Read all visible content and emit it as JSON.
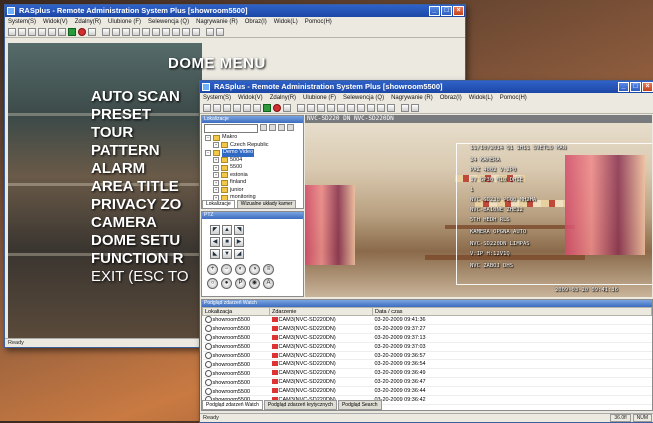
{
  "back_window": {
    "title": "RASplus - Remote Administration System Plus [showroom5500]",
    "menu": [
      "System(S)",
      "Widok(V)",
      "Zdalny(R)",
      "Ulubione (F)",
      "Selewencja (Q)",
      "Nagrywanie (R)",
      "Obraz(I)",
      "Widok(L)",
      "Pomoc(H)"
    ],
    "status": "Ready",
    "dome_menu": {
      "title": "DOME MENU",
      "items": [
        "AUTO SCAN",
        "PRESET",
        "TOUR",
        "PATTERN",
        "ALARM",
        "AREA TITLE",
        "PRIVACY ZO",
        "CAMERA",
        "DOME SETU",
        "FUNCTION R"
      ],
      "exit": "EXIT (ESC TO"
    }
  },
  "front_window": {
    "title": "RASplus - Remote Administration System Plus [showroom5500]",
    "menu": [
      "System(S)",
      "Widok(V)",
      "Zdalny(R)",
      "Ulubione (F)",
      "Selewencja (Q)",
      "Nagrywanie (R)",
      "Obraz(I)",
      "Widok(L)",
      "Pomoc(H)"
    ],
    "locations_panel": {
      "header": "Lokalizacje",
      "tree": [
        {
          "label": "Makro",
          "level": 0
        },
        {
          "label": "Czech Republic",
          "level": 1
        },
        {
          "label": "Demo Video",
          "level": 0,
          "selected": true
        },
        {
          "label": "5004",
          "level": 1
        },
        {
          "label": "5500",
          "level": 1
        },
        {
          "label": "estonia",
          "level": 1
        },
        {
          "label": "finland",
          "level": 1
        },
        {
          "label": "junior",
          "level": 1
        },
        {
          "label": "monitoring",
          "level": 1
        }
      ],
      "tabs": [
        "Lokalizacje",
        "Wizualne układy kamer"
      ]
    },
    "ptz_panel": {
      "header": "PTZ"
    },
    "video": {
      "title": "NVC-SD220 DN  NVC-SD220DN",
      "osd_lines": [
        "11/10/2014 Q1  1H11 SVETLO MAN",
        "24 KAMERA",
        "PAZ 4002  V:2P0",
        "3V GP30 M10 DHIE",
        "1",
        "NVC-SD230 PC00  MH2HA",
        "NVC-BA10NE  ZHE12",
        "5TH HEDH RLS",
        "KAMERA  OPGNA AUTO",
        "NVC-SD220DN  LIMPAS",
        "V:IP H:12V1Q",
        "NVC ZABOJ DHS"
      ],
      "timestamp": "2009-03-20 09:41:36"
    },
    "events_panel": {
      "header": "Podgląd zdarzeń Watch",
      "columns": [
        "Lokalizacja",
        "Zdarzenie",
        "Data / czas"
      ],
      "rows": [
        {
          "location": "showroom5500",
          "event": "CAM3(NVC-SD220DN)",
          "time": "03-20-2009 09:41:36"
        },
        {
          "location": "showroom5500",
          "event": "CAM3(NVC-SD220DN)",
          "time": "03-20-2009 09:37:27"
        },
        {
          "location": "showroom5500",
          "event": "CAM3(NVC-SD220DN)",
          "time": "03-20-2009 09:37:13"
        },
        {
          "location": "showroom5500",
          "event": "CAM3(NVC-SD220DN)",
          "time": "03-20-2009 09:37:03"
        },
        {
          "location": "showroom5500",
          "event": "CAM3(NVC-SD220DN)",
          "time": "03-20-2009 09:36:57"
        },
        {
          "location": "showroom5500",
          "event": "CAM3(NVC-SD220DN)",
          "time": "03-20-2009 09:36:54"
        },
        {
          "location": "showroom5500",
          "event": "CAM3(NVC-SD220DN)",
          "time": "03-20-2009 09:36:49"
        },
        {
          "location": "showroom5500",
          "event": "CAM3(NVC-SD220DN)",
          "time": "03-20-2009 09:36:47"
        },
        {
          "location": "showroom5500",
          "event": "CAM3(NVC-SD220DN)",
          "time": "03-20-2009 09:36:44"
        },
        {
          "location": "showroom5500",
          "event": "CAM3(NVC-SD220DN)",
          "time": "03-20-2009 09:36:42"
        }
      ],
      "tabs": [
        "Podgląd zdarzeń Watch",
        "Podgląd zdarzeń krytycznych",
        "Podgląd Search"
      ]
    },
    "status": "Ready",
    "status_right": [
      "36.0fl",
      "NUM"
    ]
  },
  "colors": {
    "titlebar": "#1c47a6",
    "chrome": "#ece9e1",
    "selection": "#316ac5"
  }
}
